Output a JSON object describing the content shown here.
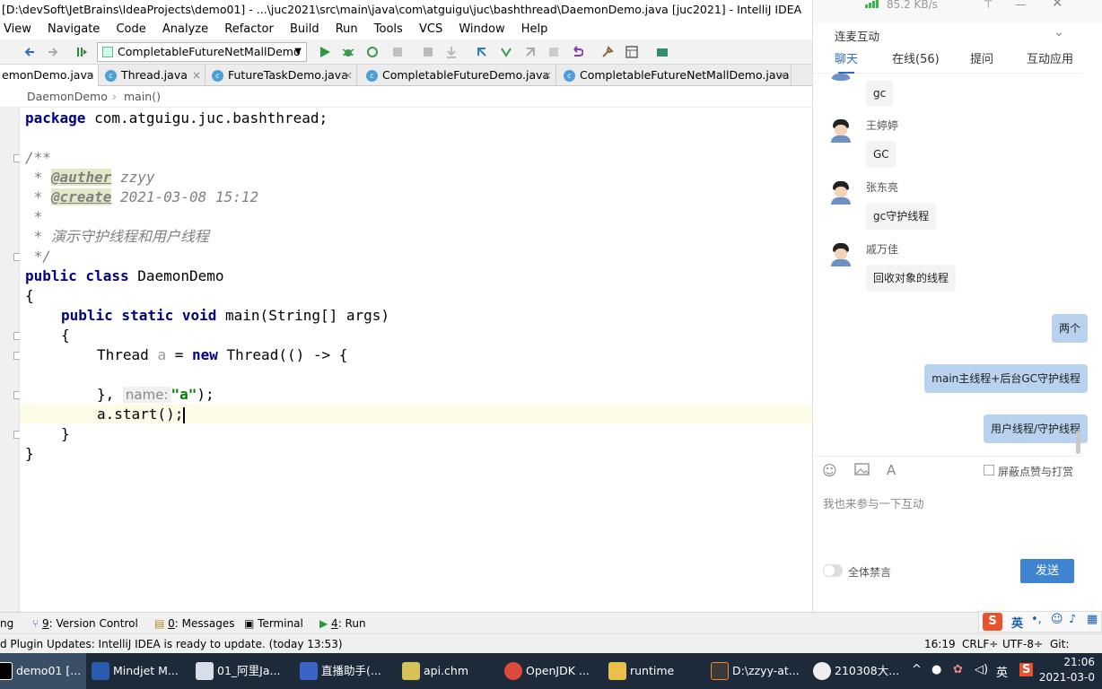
{
  "window": {
    "title": "[D:\\devSoft\\JetBrains\\IdeaProjects\\demo01] - ...\\juc2021\\src\\main\\java\\com\\atguigu\\juc\\bashthread\\DaemonDemo.java [juc2021] - IntelliJ IDEA"
  },
  "menu": [
    "View",
    "Navigate",
    "Code",
    "Analyze",
    "Refactor",
    "Build",
    "Run",
    "Tools",
    "VCS",
    "Window",
    "Help"
  ],
  "toolbar": {
    "run_config": "CompletableFutureNetMallDemo"
  },
  "tabs": [
    "emonDemo.java",
    "Thread.java",
    "FutureTaskDemo.java",
    "CompletableFutureDemo.java",
    "CompletableFutureNetMallDemo.java"
  ],
  "breadcrumb": [
    "DaemonDemo",
    "main()"
  ],
  "code": {
    "l1_kw": "package",
    "l1_rest": " com.atguigu.juc.bashthread;",
    "l3": "/**",
    "l4_star": " * ",
    "l4_tag": "@auther",
    "l4_val": " zzyy",
    "l5_star": " * ",
    "l5_tag": "@create",
    "l5_val": " 2021-03-08 15:12",
    "l6": " *",
    "l7": " * 演示守护线程和用户线程",
    "l8": " */",
    "l9_kw": "public class",
    "l9_rest": " DaemonDemo",
    "l10": "{",
    "l11_kw": "public static void",
    "l11_rest": " main(String[] args)",
    "l12": "{",
    "l13_a": "Thread ",
    "l13_var": "a",
    "l13_b": " = ",
    "l13_kw": "new",
    "l13_c": " Thread(() -> {",
    "l15_a": "}, ",
    "l15_hint": "name:",
    "l15_str": "\"a\"",
    "l15_b": ");",
    "l16": "a.start();",
    "l17": "}",
    "l18": "}"
  },
  "chat": {
    "speed": "85.2 KB/s",
    "section": "连麦互动",
    "tabs": [
      "聊天",
      "在线(56)",
      "提问",
      "互动应用"
    ],
    "messages": [
      {
        "sender": "",
        "text": "gc"
      },
      {
        "sender": "王婷婷",
        "text": "GC"
      },
      {
        "sender": "张东亮",
        "text": "gc守护线程"
      },
      {
        "sender": "戚万佳",
        "text": "回收对象的线程"
      }
    ],
    "my_messages": [
      "两个",
      "main主线程+后台GC守护线程",
      "用户线程/守护线程"
    ],
    "block_label": "屏蔽点赞与打赏",
    "input_placeholder": "我也来参与一下互动",
    "mute_label": "全体禁言",
    "send": "发送"
  },
  "tool_windows": [
    {
      "num": "",
      "label": "ng"
    },
    {
      "num": "9",
      "label": ": Version Control"
    },
    {
      "num": "0",
      "label": ": Messages"
    },
    {
      "num": "",
      "label": "Terminal"
    },
    {
      "num": "4",
      "label": ": Run"
    }
  ],
  "status": {
    "message": "d Plugin Updates: IntelliJ IDEA is ready to update. (today 13:53)",
    "position": "16:19",
    "line_sep": "CRLF÷",
    "encoding": "UTF-8÷",
    "git": "Git: maste"
  },
  "taskbar": {
    "items": [
      "demo01 [...",
      "Mindjet M...",
      "01_阿里Ja...",
      "直播助手(...",
      "api.chm",
      "OpenJDK ...",
      "runtime",
      "D:\\zzyy-at...",
      "210308大..."
    ],
    "time": "21:06",
    "date": "2021-03-0",
    "lang": "英"
  },
  "colors": {
    "accent": "#2a6ebd",
    "send": "#3f84d0",
    "my_bubble": "#b9d2ef",
    "keyword": "#000080",
    "string": "#008000"
  }
}
